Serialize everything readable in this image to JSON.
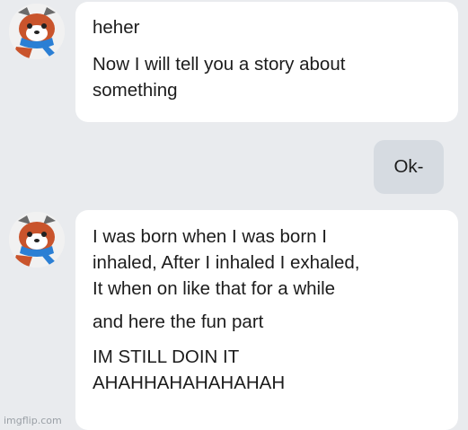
{
  "messages": [
    {
      "direction": "incoming",
      "avatar": "red-panda-avatar",
      "lines": [
        "heher",
        "Now I will tell you a story about\nsomething"
      ]
    },
    {
      "direction": "outgoing",
      "lines": [
        "Ok-"
      ]
    },
    {
      "direction": "incoming",
      "avatar": "red-panda-avatar",
      "lines": [
        "I was born when I was born I\ninhaled, After I inhaled I exhaled,\nIt when on like that for a while",
        "and here the fun part",
        "IM STILL DOIN IT\nAHAHHAHAHAHAHAH"
      ]
    }
  ],
  "watermark": "imgflip.com",
  "colors": {
    "background": "#e9ebee",
    "incoming_bubble": "#ffffff",
    "outgoing_bubble": "#d6dbe1",
    "text": "#1c1c1c"
  }
}
